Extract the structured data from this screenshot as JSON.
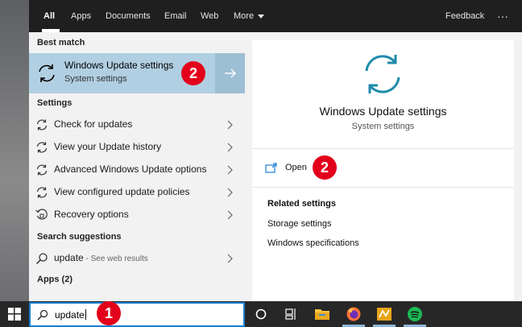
{
  "tabs": [
    {
      "label": "All",
      "active": true
    },
    {
      "label": "Apps"
    },
    {
      "label": "Documents"
    },
    {
      "label": "Email"
    },
    {
      "label": "Web"
    },
    {
      "label": "More"
    }
  ],
  "feedback_label": "Feedback",
  "more_options_glyph": "···",
  "sections": {
    "best_match": "Best match",
    "settings": "Settings",
    "search_suggestions": "Search suggestions",
    "apps": "Apps (2)"
  },
  "best_match": {
    "title": "Windows Update settings",
    "subtitle": "System settings",
    "icon": "sync-icon"
  },
  "settings_items": [
    {
      "label": "Check for updates",
      "icon": "sync-icon"
    },
    {
      "label": "View your Update history",
      "icon": "sync-icon"
    },
    {
      "label": "Advanced Windows Update options",
      "icon": "sync-icon"
    },
    {
      "label": "View configured update policies",
      "icon": "sync-icon"
    },
    {
      "label": "Recovery options",
      "icon": "recovery-icon"
    }
  ],
  "suggestion": {
    "query": "update",
    "suffix": " - See web results"
  },
  "detail": {
    "title": "Windows Update settings",
    "subtitle": "System settings",
    "open_label": "Open",
    "related_heading": "Related settings",
    "related": [
      "Storage settings",
      "Windows specifications"
    ]
  },
  "search": {
    "value": "update"
  },
  "badges": {
    "one": "1",
    "two": "2"
  },
  "colors": {
    "accent": "#1a7dd1",
    "best_match_bg": "#b1cfe2",
    "badge": "#e3001b",
    "sync_icon": "#1e8bab",
    "topbar": "#1f1f1f",
    "taskbar": "#272727"
  }
}
